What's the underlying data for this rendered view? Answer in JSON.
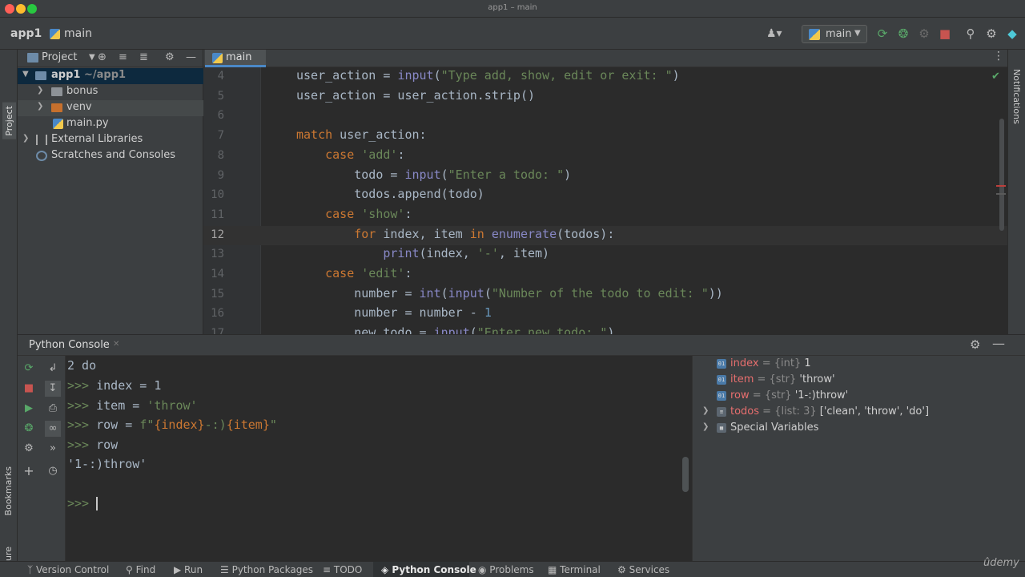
{
  "window": {
    "title": "app1 – main"
  },
  "navbar": {
    "project": "app1",
    "file": "main",
    "run_config": "main",
    "colors": {
      "run": "#59a869",
      "stop": "#c75450"
    }
  },
  "left_strip": {
    "project_tab": "Project",
    "bookmarks_tab": "Bookmarks",
    "structure_tab": "Structure"
  },
  "right_strip": {
    "notifications_tab": "Notifications"
  },
  "project_panel": {
    "title": "Project",
    "tree": [
      {
        "label": "app1",
        "sub": "~/app1"
      },
      {
        "label": "bonus"
      },
      {
        "label": "venv"
      },
      {
        "label": "main.py"
      },
      {
        "label": "External Libraries"
      },
      {
        "label": "Scratches and Consoles"
      }
    ]
  },
  "editor": {
    "tab": "main",
    "line_numbers": [
      "4",
      "5",
      "6",
      "7",
      "8",
      "9",
      "10",
      "11",
      "12",
      "13",
      "14",
      "15",
      "16",
      "17"
    ]
  },
  "console": {
    "title": "Python Console",
    "output": {
      "line0": "2 do",
      "prompt": ">>>",
      "in1": "index = 1",
      "in2_a": "item = ",
      "in2_b": "'throw'",
      "in3_a": "row = ",
      "in3_b": "f\"",
      "in3_c": "{index}",
      "in3_d": "-:)",
      "in3_e": "{item}",
      "in3_f": "\"",
      "in4": "row",
      "out": "'1-:)throw'"
    }
  },
  "variables": [
    {
      "name": "index",
      "type": " = {int} ",
      "value": "1"
    },
    {
      "name": "item",
      "type": " = {str} ",
      "value": "'throw'"
    },
    {
      "name": "row",
      "type": " = {str} ",
      "value": "'1-:)throw'"
    },
    {
      "name": "todos",
      "type": " = {list: 3} ",
      "value": "['clean', 'throw', 'do']"
    },
    {
      "name": "Special Variables",
      "type": "",
      "value": ""
    }
  ],
  "statusbar": {
    "items": [
      "Version Control",
      "Find",
      "Run",
      "Python Packages",
      "TODO",
      "Python Console",
      "Problems",
      "Terminal",
      "Services"
    ]
  },
  "watermark": "ûdemy"
}
